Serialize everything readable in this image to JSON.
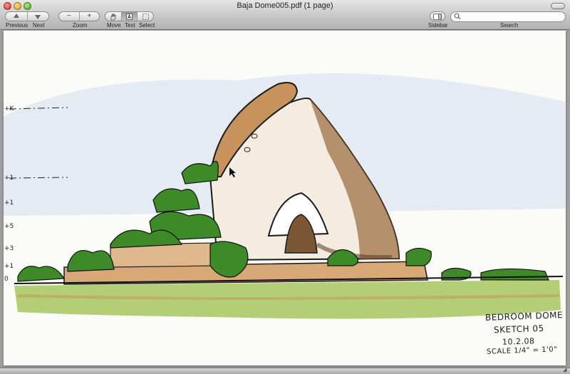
{
  "window": {
    "title": "Baja Dome005.pdf (1 page)"
  },
  "toolbar": {
    "previous_label": "Previous",
    "next_label": "Next",
    "zoom_label": "Zoom",
    "zoom_out_symbol": "−",
    "zoom_in_symbol": "+",
    "move_label": "Move",
    "text_label": "Text",
    "select_label": "Select",
    "sidebar_label": "Sidebar",
    "search_label": "Search",
    "search_value": "",
    "search_placeholder": ""
  },
  "sketch": {
    "elevation_marks": [
      "+K",
      "+1",
      "+1",
      "+5",
      "+3",
      "+1",
      "0"
    ],
    "notes": [
      "BEDROOM DOME",
      "SKETCH 05",
      "10.2.08",
      "SCALE 1/4\" = 1'0\""
    ]
  },
  "colors": {
    "paper": "#fbfbf8",
    "sky_wash": "#b9cde8",
    "dome_shade": "#9a6a3c",
    "foliage": "#3f8a28",
    "grass": "#9cc25a"
  }
}
